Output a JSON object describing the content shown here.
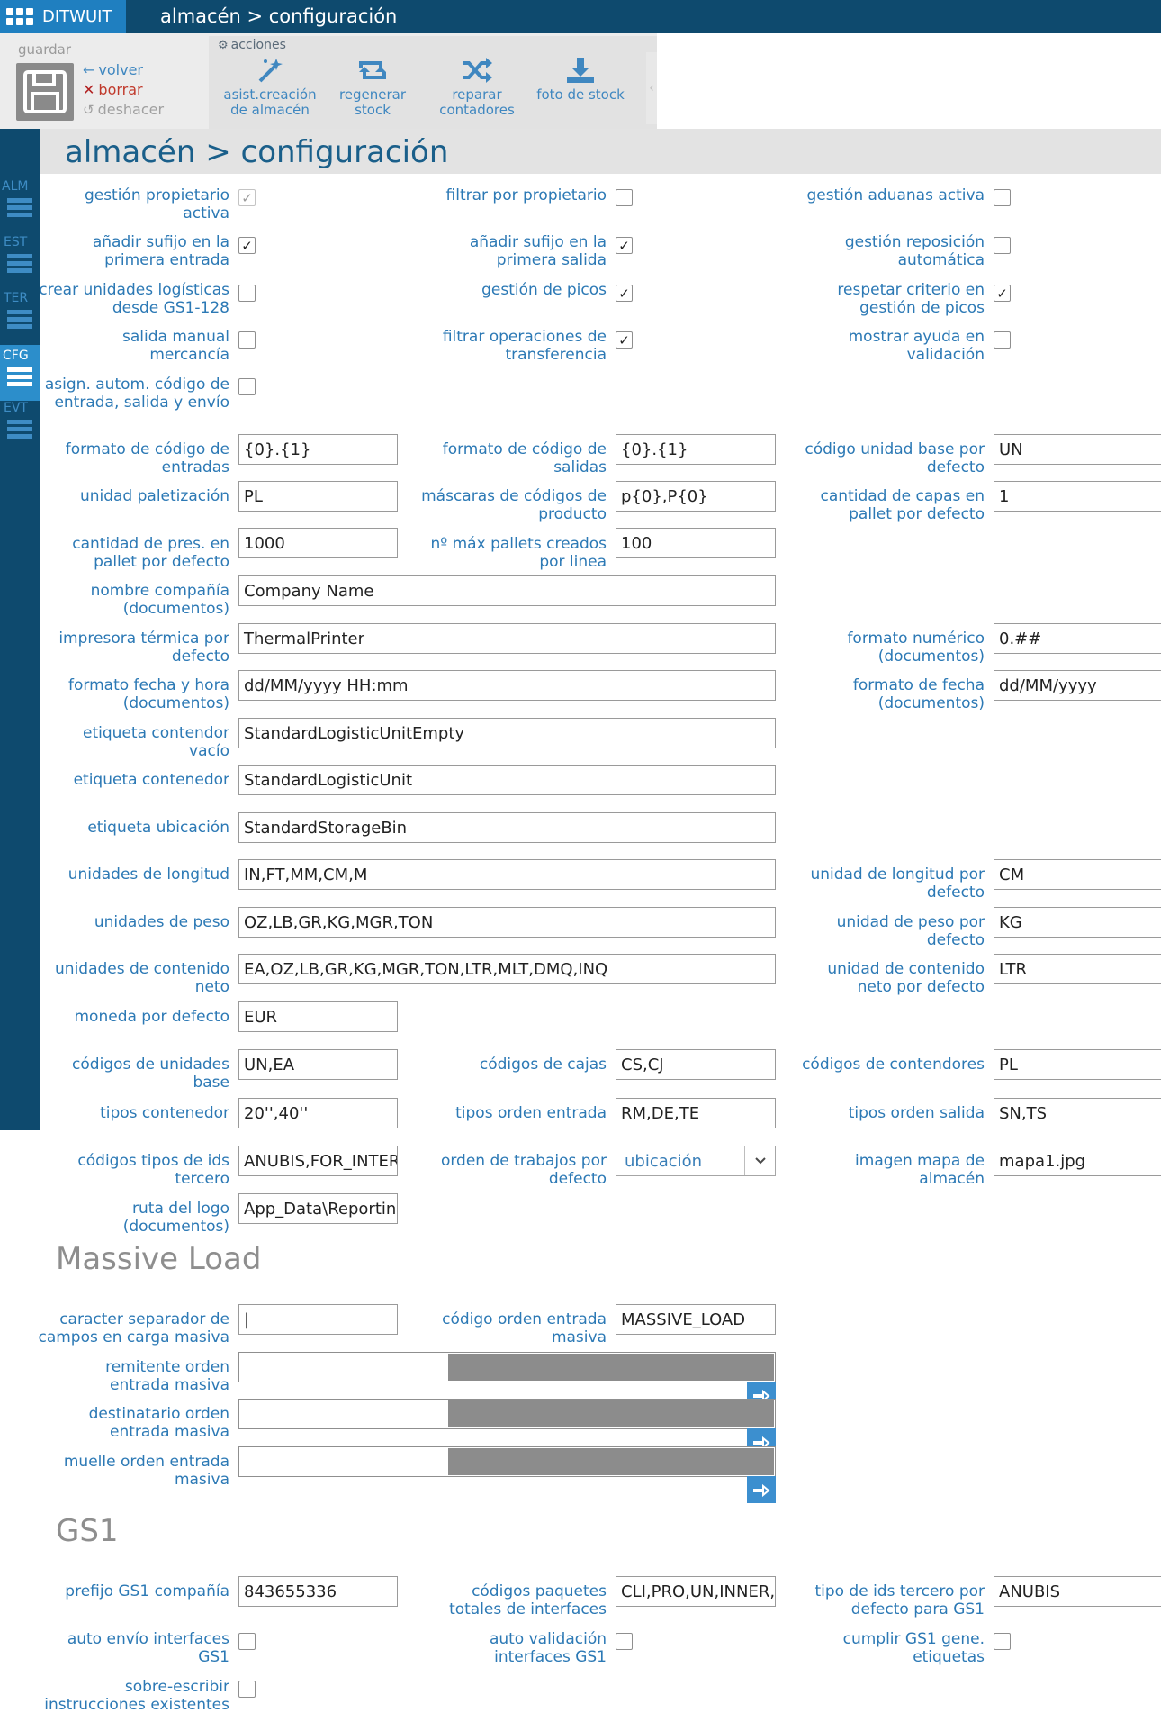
{
  "app": {
    "brand": "DITWUIT",
    "top_title": "almacén > configuración"
  },
  "toolbar": {
    "guardar": "guardar",
    "volver": "volver",
    "borrar": "borrar",
    "deshacer": "deshacer",
    "acciones": "acciones",
    "actions": [
      {
        "line1": "asist.creación",
        "line2": "de almacén",
        "icon": "magic-wand-icon"
      },
      {
        "line1": "regenerar",
        "line2": "stock",
        "icon": "retweet-icon"
      },
      {
        "line1": "reparar",
        "line2": "contadores",
        "icon": "shuffle-icon"
      },
      {
        "line1": "foto de stock",
        "line2": "",
        "icon": "download-icon"
      }
    ],
    "collapse_glyph": "‹"
  },
  "sidebar": {
    "items": [
      {
        "label": "ALM"
      },
      {
        "label": "EST"
      },
      {
        "label": "TER"
      },
      {
        "label": "CFG",
        "active": true
      },
      {
        "label": "EVT"
      }
    ]
  },
  "page_title": "almacén > configuración",
  "checkboxes": [
    {
      "label1": "gestión propietario",
      "label2": "activa",
      "checked": true,
      "disabled": true
    },
    {
      "label1": "filtrar por propietario",
      "label2": "",
      "checked": false
    },
    {
      "label1": "gestión aduanas activa",
      "label2": "",
      "checked": false
    },
    {
      "label1": "añadir sufijo en la",
      "label2": "primera entrada",
      "checked": true
    },
    {
      "label1": "añadir sufijo en la",
      "label2": "primera salida",
      "checked": true
    },
    {
      "label1": "gestión reposición",
      "label2": "automática",
      "checked": false
    },
    {
      "label1": "crear unidades logísticas",
      "label2": "desde GS1-128",
      "checked": false
    },
    {
      "label1": "gestión de picos",
      "label2": "",
      "checked": true
    },
    {
      "label1": "respetar criterio en",
      "label2": "gestión de picos",
      "checked": true
    },
    {
      "label1": "salida manual",
      "label2": "mercancía",
      "checked": false
    },
    {
      "label1": "filtrar operaciones de",
      "label2": "transferencia",
      "checked": true
    },
    {
      "label1": "mostrar ayuda en",
      "label2": "validación",
      "checked": false
    },
    {
      "label1": "asign. autom. código de",
      "label2": "entrada, salida y envío",
      "checked": false
    }
  ],
  "fields": [
    {
      "label1": "formato de código de",
      "label2": "entradas",
      "value": "{0}.{1}"
    },
    {
      "label1": "formato de código de",
      "label2": "salidas",
      "value": "{0}.{1}"
    },
    {
      "label1": "código unidad base por",
      "label2": "defecto",
      "value": "UN"
    },
    {
      "label1": "unidad paletización",
      "label2": "",
      "value": "PL"
    },
    {
      "label1": "máscaras de códigos de",
      "label2": "producto",
      "value": "p{0},P{0}"
    },
    {
      "label1": "cantidad de capas en",
      "label2": "pallet por defecto",
      "value": "1"
    },
    {
      "label1": "cantidad de pres. en",
      "label2": "pallet por defecto",
      "value": "1000"
    },
    {
      "label1": "nº máx pallets creados",
      "label2": "por linea",
      "value": "100"
    },
    {
      "label1": "nombre compañía",
      "label2": "(documentos)",
      "value": "Company Name"
    },
    {
      "label1": "impresora térmica por",
      "label2": "defecto",
      "value": "ThermalPrinter"
    },
    {
      "label1": "formato numérico",
      "label2": "(documentos)",
      "value": "0.##"
    },
    {
      "label1": "formato fecha y hora",
      "label2": "(documentos)",
      "value": "dd/MM/yyyy HH:mm"
    },
    {
      "label1": "formato de fecha",
      "label2": "(documentos)",
      "value": "dd/MM/yyyy"
    },
    {
      "label1": "etiqueta contendor",
      "label2": "vacío",
      "value": "StandardLogisticUnitEmpty"
    },
    {
      "label1": "etiqueta contenedor",
      "label2": "",
      "value": "StandardLogisticUnit"
    },
    {
      "label1": "etiqueta ubicación",
      "label2": "",
      "value": "StandardStorageBin"
    },
    {
      "label1": "unidades de longitud",
      "label2": "",
      "value": "IN,FT,MM,CM,M"
    },
    {
      "label1": "unidad de longitud por",
      "label2": "defecto",
      "value": "CM"
    },
    {
      "label1": "unidades de peso",
      "label2": "",
      "value": "OZ,LB,GR,KG,MGR,TON"
    },
    {
      "label1": "unidad de peso por",
      "label2": "defecto",
      "value": "KG"
    },
    {
      "label1": "unidades de contenido",
      "label2": "neto",
      "value": "EA,OZ,LB,GR,KG,MGR,TON,LTR,MLT,DMQ,INQ"
    },
    {
      "label1": "unidad de contenido",
      "label2": "neto por defecto",
      "value": "LTR"
    },
    {
      "label1": "moneda por defecto",
      "label2": "",
      "value": "EUR"
    },
    {
      "label1": "códigos de unidades",
      "label2": "base",
      "value": "UN,EA"
    },
    {
      "label1": "códigos de cajas",
      "label2": "",
      "value": "CS,CJ"
    },
    {
      "label1": "códigos de contendores",
      "label2": "",
      "value": "PL"
    },
    {
      "label1": "tipos contenedor",
      "label2": "",
      "value": "20'',40''"
    },
    {
      "label1": "tipos orden entrada",
      "label2": "",
      "value": "RM,DE,TE"
    },
    {
      "label1": "tipos orden salida",
      "label2": "",
      "value": "SN,TS"
    },
    {
      "label1": "códigos tipos de ids",
      "label2": "tercero",
      "value": "ANUBIS,FOR_INTER"
    },
    {
      "label1": "orden de trabajos por",
      "label2": "defecto",
      "value": "ubicación",
      "type": "select"
    },
    {
      "label1": "imagen mapa de",
      "label2": "almacén",
      "value": "mapa1.jpg"
    },
    {
      "label1": "ruta del logo",
      "label2": "(documentos)",
      "value": "App_Data\\Reportin"
    }
  ],
  "massive_load": {
    "title": "Massive Load",
    "fields": [
      {
        "label1": "caracter separador de",
        "label2": "campos en carga masiva",
        "value": "|"
      },
      {
        "label1": "código orden entrada",
        "label2": "masiva",
        "value": "MASSIVE_LOAD"
      }
    ],
    "lookups": [
      {
        "label1": "remitente orden",
        "label2": "entrada masiva"
      },
      {
        "label1": "destinatario orden",
        "label2": "entrada masiva"
      },
      {
        "label1": "muelle orden entrada",
        "label2": "masiva"
      }
    ]
  },
  "gs1": {
    "title": "GS1",
    "fields": [
      {
        "label1": "prefijo GS1 compañía",
        "label2": "",
        "value": "843655336"
      },
      {
        "label1": "códigos paquetes",
        "label2": "totales de interfaces",
        "value": "CLI,PRO,UN,INNER,"
      },
      {
        "label1": "tipo de ids tercero por",
        "label2": "defecto para GS1",
        "value": "ANUBIS"
      }
    ],
    "checkboxes": [
      {
        "label1": "auto envío interfaces",
        "label2": "GS1",
        "checked": false
      },
      {
        "label1": "auto validación",
        "label2": "interfaces GS1",
        "checked": false
      },
      {
        "label1": "cumplir GS1 gene.",
        "label2": "etiquetas",
        "checked": false
      },
      {
        "label1": "sobre-escribir",
        "label2": "instrucciones existentes",
        "checked": false
      }
    ]
  },
  "colors": {
    "topbar": "#0e4a6e",
    "brand": "#1f7fc0",
    "label": "#2c79b5",
    "accent": "#3c8fcf"
  }
}
